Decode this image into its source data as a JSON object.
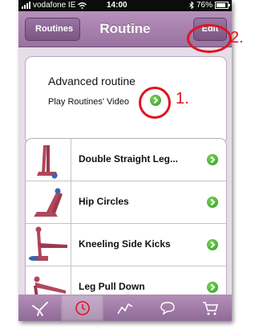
{
  "status_bar": {
    "carrier": "vodafone IE",
    "time": "14:00",
    "battery": "76%"
  },
  "nav": {
    "back_label": "Routines",
    "title": "Routine",
    "edit_label": "Edit"
  },
  "routine": {
    "name": "Advanced routine",
    "video_label": "Play Routines' Video"
  },
  "annotations": {
    "first": "1.",
    "second": "2."
  },
  "exercises": [
    {
      "label": "Double Straight Leg..."
    },
    {
      "label": "Hip Circles"
    },
    {
      "label": "Kneeling Side Kicks"
    },
    {
      "label": "Leg Pull Down"
    }
  ],
  "tabs": [
    {
      "icon": "exercise-icon"
    },
    {
      "icon": "clock-icon",
      "selected": true
    },
    {
      "icon": "chart-icon"
    },
    {
      "icon": "speech-bubble-icon"
    },
    {
      "icon": "cart-icon"
    }
  ],
  "colors": {
    "nav_purple": "#9872a0",
    "annotation_red": "#e0141e",
    "chevron_green": "#2e9b23",
    "figure_red": "#b2465a",
    "ball_blue": "#3566b5"
  }
}
